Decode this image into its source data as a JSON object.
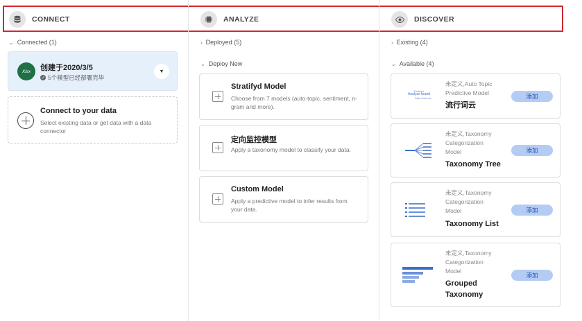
{
  "columns": {
    "connect": {
      "label": "CONNECT",
      "icon": "database-icon"
    },
    "analyze": {
      "label": "ANALYZE",
      "icon": "chip-icon"
    },
    "discover": {
      "label": "DISCOVER",
      "icon": "eye-icon"
    }
  },
  "connect": {
    "section_label": "Connected (1)",
    "dataset": {
      "badge": "Xlsx",
      "title": "创建于2020/3/5",
      "status": "5个模型已经部署完毕"
    },
    "connect_card": {
      "title": "Connect to your data",
      "description": "Select existing data or get data with a data connector"
    }
  },
  "analyze": {
    "deployed_label": "Deployed (5)",
    "deploy_new_label": "Deploy New",
    "models": [
      {
        "title": "Stratifyd Model",
        "description": "Choose from 7 models (auto-topic, sentiment, n-gram and more)."
      },
      {
        "title": "定向监控模型",
        "description": "Apply a taxonomy model to classify your data."
      },
      {
        "title": "Custom Model",
        "description": "Apply a predictive model to infer results from your data."
      }
    ]
  },
  "discover": {
    "existing_label": "Existing (4)",
    "available_label": "Available (4)",
    "items": [
      {
        "meta": [
          "未定义,Auto Topic",
          "Predictive Model"
        ],
        "title": [
          "流行词云"
        ],
        "add_label": "添加",
        "thumb_words": [
          "Stratifyd",
          "Analyze brand",
          "Data Science"
        ]
      },
      {
        "meta": [
          "未定义,Taxonomy",
          "Categorization",
          "Model"
        ],
        "title": [
          "Taxonomy Tree"
        ],
        "add_label": "添加"
      },
      {
        "meta": [
          "未定义,Taxonomy",
          "Categorization",
          "Model"
        ],
        "title": [
          "Taxonomy List"
        ],
        "add_label": "添加"
      },
      {
        "meta": [
          "未定义,Taxonomy",
          "Categorization",
          "Model"
        ],
        "title": [
          "Grouped",
          "Taxonomy"
        ],
        "add_label": "添加"
      }
    ]
  },
  "colors": {
    "accent": "#b4ccf4",
    "accent_text": "#1f4fae",
    "highlight": "#d0282e",
    "selected_bg": "#e6f0fb"
  }
}
